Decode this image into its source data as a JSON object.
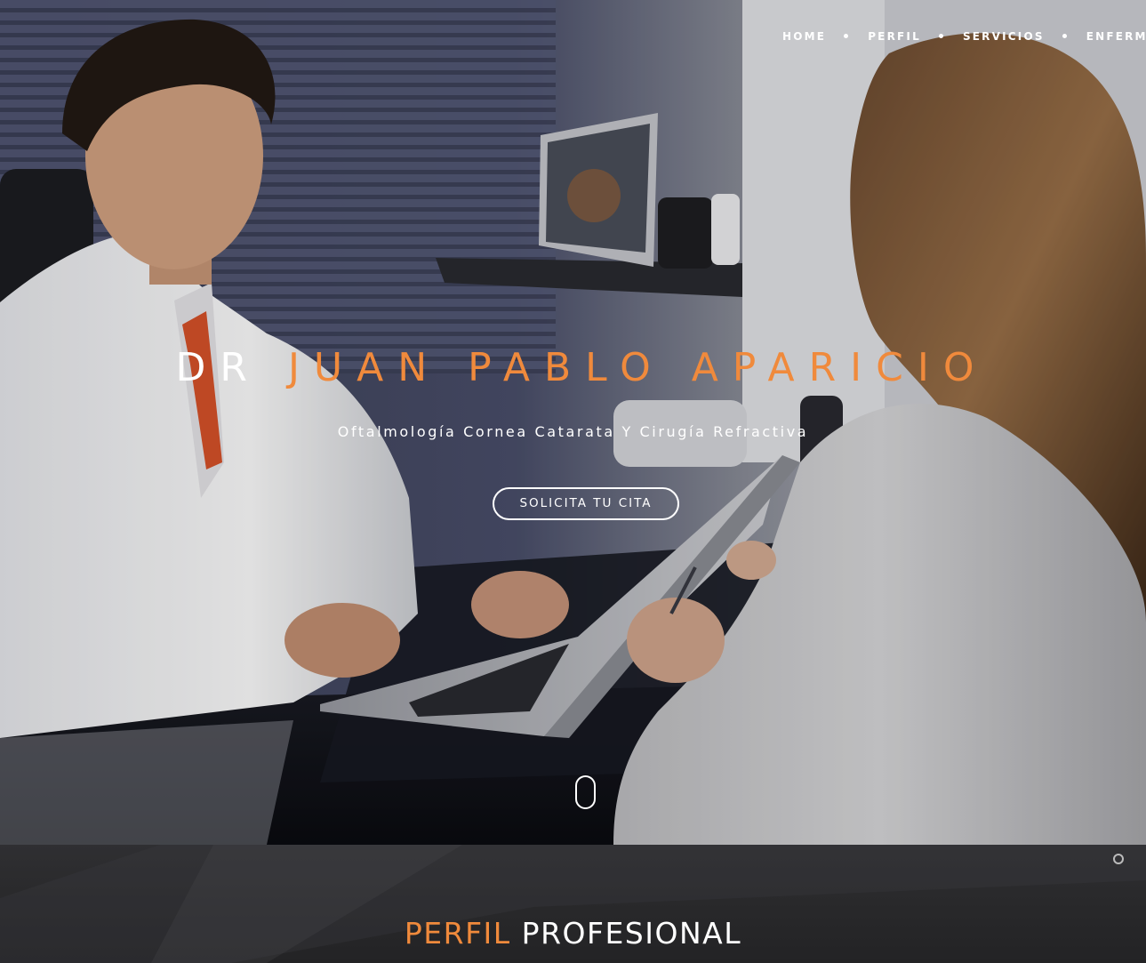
{
  "nav": {
    "items": [
      "HOME",
      "PERFIL",
      "SERVICIOS",
      "ENFERMED"
    ]
  },
  "hero": {
    "title_prefix": "DR",
    "title_name": "JUAN PABLO APARICIO",
    "subtitle": "Oftalmología Cornea Catarata Y Cirugía Refractiva",
    "cta_label": "SOLICITA TU CITA"
  },
  "section": {
    "title_accent": "PERFIL",
    "title_main": "PROFESIONAL"
  },
  "colors": {
    "accent": "#f08a3c",
    "text_light": "#ffffff",
    "section_bg": "#2a2a2c"
  },
  "icons": {
    "scroll": "mouse-scroll-icon",
    "corner": "circle-icon"
  }
}
